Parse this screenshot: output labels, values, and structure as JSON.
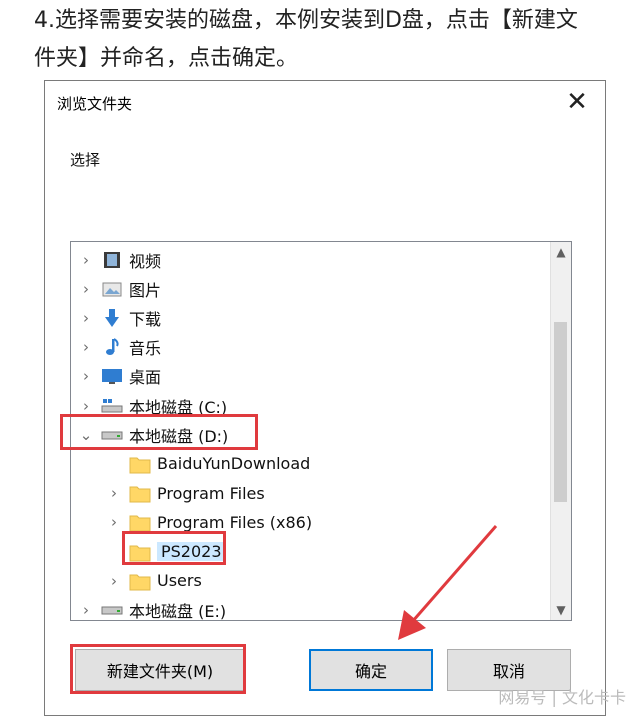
{
  "instruction": {
    "line1": "4.选择需要安装的磁盘，本例安装到D盘，点击【新建文",
    "line2": "件夹】并命名，点击确定。"
  },
  "dialog": {
    "title": "浏览文件夹",
    "prompt": "选择",
    "tree": [
      {
        "label": "视频",
        "icon": "video-library-icon",
        "expandable": true
      },
      {
        "label": "图片",
        "icon": "pictures-library-icon",
        "expandable": true
      },
      {
        "label": "下载",
        "icon": "downloads-icon",
        "expandable": true
      },
      {
        "label": "音乐",
        "icon": "music-note-icon",
        "expandable": true
      },
      {
        "label": "桌面",
        "icon": "desktop-icon",
        "expandable": true
      },
      {
        "label": "本地磁盘 (C:)",
        "icon": "system-drive-icon",
        "expandable": true
      },
      {
        "label": "本地磁盘 (D:)",
        "icon": "drive-icon",
        "expandable": true,
        "expanded": true
      },
      {
        "label": "BaiduYunDownload",
        "icon": "folder-icon",
        "expandable": false
      },
      {
        "label": "Program Files",
        "icon": "folder-icon",
        "expandable": true
      },
      {
        "label": "Program Files (x86)",
        "icon": "folder-icon",
        "expandable": true
      },
      {
        "label": "PS2023",
        "icon": "folder-icon",
        "expandable": false,
        "selected": true
      },
      {
        "label": "Users",
        "icon": "folder-icon",
        "expandable": true
      },
      {
        "label": "本地磁盘 (E:)",
        "icon": "drive-icon",
        "expandable": true
      }
    ],
    "buttons": {
      "new_folder": "新建文件夹(M)",
      "ok": "确定",
      "cancel": "取消"
    }
  },
  "watermark": "网易号 | 文化卡卡",
  "colors": {
    "annotation_red": "#e03a3e",
    "selection": "#cce8ff",
    "folder": "#ffd766",
    "accent": "#0078d7"
  }
}
